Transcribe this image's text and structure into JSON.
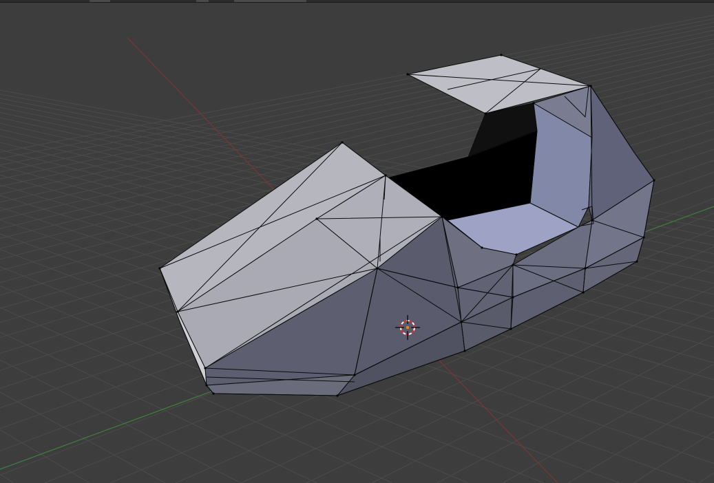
{
  "viewport": {
    "editor_type": "3d-viewport",
    "mode": "edit-mode",
    "display": "solid-with-wireframe-overlay",
    "object": "car-body-mesh",
    "colors": {
      "background": "#3d3d3d",
      "grid": "#4a4a4a",
      "x_axis": "#8a3a3a",
      "y_axis": "#3f8a3f",
      "mesh_light": "#b7b7bf",
      "mesh_mid": "#7b7d8e",
      "mesh_dark": "#555768",
      "mesh_interior": "#9a9fbf",
      "wire": "#0a0a0a",
      "cursor_red": "#e03030"
    },
    "icons": [
      "3d-cursor-icon"
    ]
  }
}
